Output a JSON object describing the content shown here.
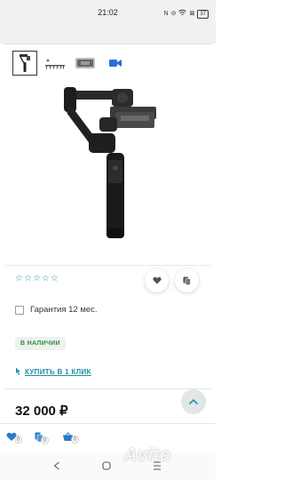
{
  "status_bar": {
    "time": "21:02",
    "icons": [
      "nfc-icon",
      "mute-icon",
      "wifi-icon",
      "x-icon",
      "battery-icon"
    ],
    "battery": "37"
  },
  "gallery": {
    "thumbnails": [
      {
        "name": "thumb-gimbal",
        "active": true
      },
      {
        "name": "thumb-accessories",
        "active": false
      },
      {
        "name": "thumb-box",
        "active": false
      },
      {
        "name": "thumb-video",
        "active": false
      }
    ],
    "video_icon_color": "#2a6fd6"
  },
  "product": {
    "rating_stars": 5,
    "rating_filled": 0,
    "warranty_label": "Гарантия 12 мес.",
    "availability": "В НАЛИЧИИ",
    "buy_one_click": "КУПИТЬ В 1 КЛИК",
    "price": "32 000 ₽"
  },
  "bottom_bar": {
    "favorites_count": "0",
    "compare_count": "0",
    "cart_count": "0"
  },
  "watermark": "Avito",
  "colors": {
    "accent": "#1e9aa6",
    "in_stock": "#2e8b3a",
    "link": "#1e8fa0"
  }
}
